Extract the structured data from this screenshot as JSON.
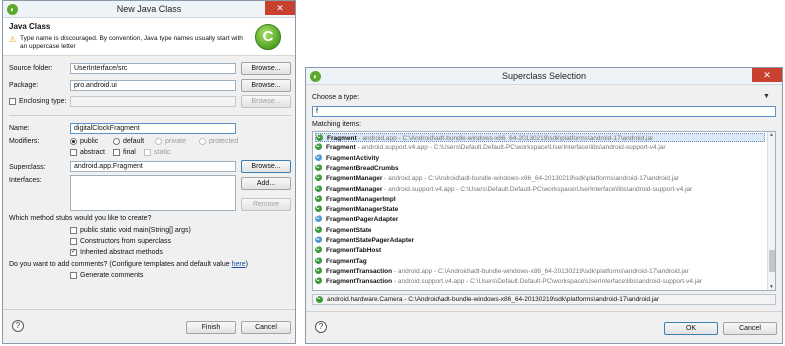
{
  "left_dialog": {
    "title": "New Java Class",
    "section_title": "Java Class",
    "warning": "Type name is discouraged. By convention, Java type names usually start with an uppercase letter",
    "source_folder": {
      "label": "Source folder:",
      "value": "UserInterface/src",
      "browse": "Browse..."
    },
    "package": {
      "label": "Package:",
      "value": "pro.android.ui",
      "browse": "Browse..."
    },
    "enclosing": {
      "label": "Enclosing type:",
      "browse": "Browse..."
    },
    "name": {
      "label": "Name:",
      "value": "digitalClockFragment"
    },
    "modifiers": {
      "label": "Modifiers:",
      "public": "public",
      "default": "default",
      "private": "private",
      "protected": "protected",
      "abstract": "abstract",
      "final": "final",
      "static": "static"
    },
    "superclass": {
      "label": "Superclass:",
      "value": "android.app.Fragment",
      "browse": "Browse..."
    },
    "interfaces": {
      "label": "Interfaces:",
      "add": "Add...",
      "remove": "Remove"
    },
    "stubs_question": "Which method stubs would you like to create?",
    "stubs": {
      "main": "public static void main(String[] args)",
      "constructors": "Constructors from superclass",
      "inherited": "Inherited abstract methods"
    },
    "comments_question": "Do you want to add comments? (Configure templates and default value ",
    "comments_link": "here",
    "comments_tail": ")",
    "generate_comments": "Generate comments",
    "finish": "Finish",
    "cancel": "Cancel"
  },
  "right_dialog": {
    "title": "Superclass Selection",
    "choose_label": "Choose a type:",
    "filter_value": "f",
    "matching_label": "Matching items:",
    "items": [
      {
        "name": "Fragment",
        "path": " - android.app - C:\\Android\\adt-bundle-windows-x86_64-20130219\\sdk\\platforms\\android-17\\android.jar"
      },
      {
        "name": "Fragment",
        "path": " - android.support.v4.app - C:\\Users\\Default.Default-PC\\workspace\\UserInterface\\libs\\android-support-v4.jar"
      },
      {
        "name": "FragmentActivity",
        "path": ""
      },
      {
        "name": "FragmentBreadCrumbs",
        "path": ""
      },
      {
        "name": "FragmentManager",
        "path": " - android.app - C:\\Android\\adt-bundle-windows-x86_64-20130219\\sdk\\platforms\\android-17\\android.jar"
      },
      {
        "name": "FragmentManager",
        "path": " - android.support.v4.app - C:\\Users\\Default.Default-PC\\workspace\\UserInterface\\libs\\android-support-v4.jar"
      },
      {
        "name": "FragmentManagerImpl",
        "path": ""
      },
      {
        "name": "FragmentManagerState",
        "path": ""
      },
      {
        "name": "FragmentPagerAdapter",
        "path": ""
      },
      {
        "name": "FragmentState",
        "path": ""
      },
      {
        "name": "FragmentStatePagerAdapter",
        "path": ""
      },
      {
        "name": "FragmentTabHost",
        "path": ""
      },
      {
        "name": "FragmentTag",
        "path": ""
      },
      {
        "name": "FragmentTransaction",
        "path": " - android.app - C:\\Android\\adt-bundle-windows-x86_64-20130219\\sdk\\platforms\\android-17\\android.jar"
      },
      {
        "name": "FragmentTransaction",
        "path": " - android.support.v4.app - C:\\Users\\Default.Default-PC\\workspace\\UserInterface\\libs\\android-support-v4.jar"
      }
    ],
    "status": "android.hardware.Camera - C:\\Android\\adt-bundle-windows-x86_64-20130219\\sdk\\platforms\\android-17\\android.jar",
    "ok": "OK",
    "cancel": "Cancel"
  }
}
